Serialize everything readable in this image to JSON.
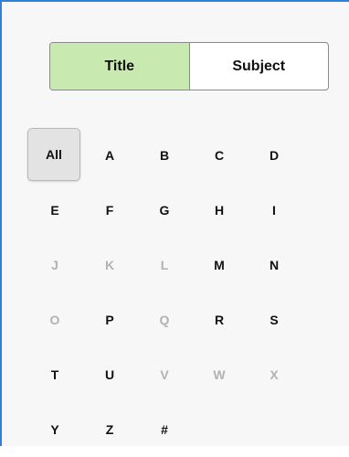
{
  "toggle": {
    "options": [
      {
        "label": "Title",
        "active": true
      },
      {
        "label": "Subject",
        "active": false
      }
    ]
  },
  "alphabet": {
    "selected": "All",
    "items": [
      {
        "label": "All",
        "enabled": true
      },
      {
        "label": "A",
        "enabled": true
      },
      {
        "label": "B",
        "enabled": true
      },
      {
        "label": "C",
        "enabled": true
      },
      {
        "label": "D",
        "enabled": true
      },
      {
        "label": "E",
        "enabled": true
      },
      {
        "label": "F",
        "enabled": true
      },
      {
        "label": "G",
        "enabled": true
      },
      {
        "label": "H",
        "enabled": true
      },
      {
        "label": "I",
        "enabled": true
      },
      {
        "label": "J",
        "enabled": false
      },
      {
        "label": "K",
        "enabled": false
      },
      {
        "label": "L",
        "enabled": false
      },
      {
        "label": "M",
        "enabled": true
      },
      {
        "label": "N",
        "enabled": true
      },
      {
        "label": "O",
        "enabled": false
      },
      {
        "label": "P",
        "enabled": true
      },
      {
        "label": "Q",
        "enabled": false
      },
      {
        "label": "R",
        "enabled": true
      },
      {
        "label": "S",
        "enabled": true
      },
      {
        "label": "T",
        "enabled": true
      },
      {
        "label": "U",
        "enabled": true
      },
      {
        "label": "V",
        "enabled": false
      },
      {
        "label": "W",
        "enabled": false
      },
      {
        "label": "X",
        "enabled": false
      },
      {
        "label": "Y",
        "enabled": true
      },
      {
        "label": "Z",
        "enabled": true
      },
      {
        "label": "#",
        "enabled": true
      }
    ]
  },
  "colors": {
    "accent_border": "#2f7fdc",
    "active_toggle": "#c8e9b0",
    "disabled_text": "#b2b2b2"
  }
}
